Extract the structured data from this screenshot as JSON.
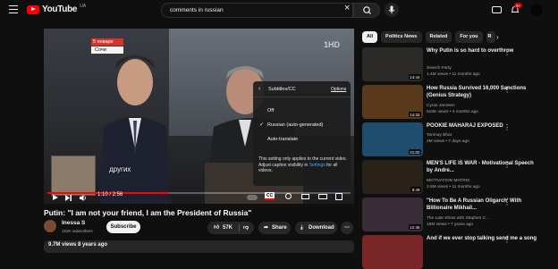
{
  "header": {
    "logo_text": "YouTube",
    "country_code": "UA",
    "search_value": "comments in russian",
    "notification_count": "9+"
  },
  "player": {
    "overlay_date": "5 января",
    "overlay_city": "Сочи",
    "channel_mark": "1HD",
    "caption": "других",
    "time": "1:10 / 2:56",
    "progress_fraction": 0.4,
    "subtitles_menu": {
      "title": "Subtitles/CC",
      "options_link": "Options",
      "items": [
        "Off",
        "Russian (auto-generated)",
        "Auto-translate"
      ],
      "selected_index": 1,
      "note_prefix": "This setting only applies to the current video. Adjust caption visibility in ",
      "note_link": "Settings",
      "note_suffix": " for all videos."
    }
  },
  "video": {
    "title": "Putin: \"I am not your friend, I am the President of Russia\"",
    "channel": "Inessa S",
    "subscribers": "163K subscribers",
    "subscribe_label": "Subscribe",
    "likes": "57K",
    "share_label": "Share",
    "download_label": "Download",
    "views_meta": "9.7M views  8 years ago"
  },
  "chips": [
    "All",
    "Politics News",
    "Related",
    "For you",
    "R"
  ],
  "recommendations": [
    {
      "title": "Why Putin is so hard to overthrow",
      "channel": "Search Party",
      "meta": "1.4M views • 11 months ago",
      "duration": "14:44",
      "thumb_color": "#2c2a26"
    },
    {
      "title": "How Russia Survived 16,000 Sanctions (Genius Strategy)",
      "channel": "Cyrus Janssen",
      "meta": "615K views • 4 months ago",
      "duration": "14:32",
      "thumb_color": "#5a3a1c"
    },
    {
      "title": "POOKIE MAHARAJ EXPOSED",
      "channel": "Tanmay Bhat",
      "meta": "4M views • 7 days ago",
      "duration": "21:02",
      "thumb_color": "#1f4d6e"
    },
    {
      "title": "MEN'S LIFE IS WAR - Motivational Speech by Andre...",
      "channel": "MOTIVATION MATRIX",
      "meta": "2.6M views • 11 months ago",
      "duration": "8:49",
      "thumb_color": "#2a2218"
    },
    {
      "title": "\"How To Be A Russian Oligarch' With Billionaire Mikhail...",
      "channel": "The Late Show with Stephen C...",
      "meta": "16M views • 7 years ago",
      "duration": "12:45",
      "thumb_color": "#3b2c3a"
    },
    {
      "title": "And if we ever stop talking send me a song",
      "channel": "",
      "meta": "",
      "duration": "",
      "thumb_color": "#7a2626"
    }
  ]
}
